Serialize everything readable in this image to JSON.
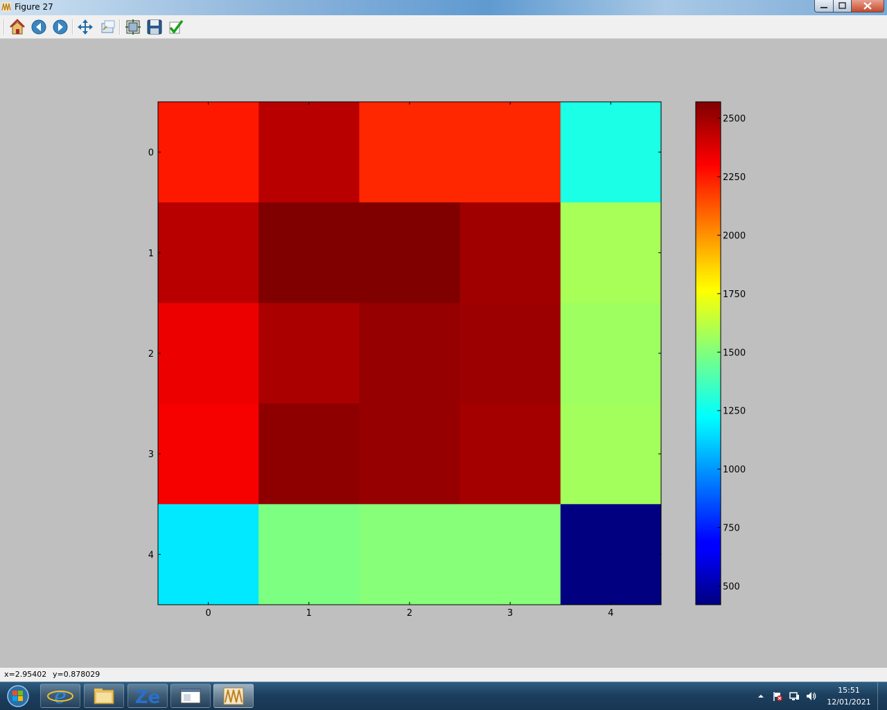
{
  "window": {
    "title": "Figure 27"
  },
  "toolbar": {
    "buttons": [
      {
        "name": "home-icon"
      },
      {
        "name": "back-icon"
      },
      {
        "name": "forward-icon"
      },
      {
        "name": "pan-icon"
      },
      {
        "name": "zoom-icon"
      },
      {
        "name": "subplots-config-icon"
      },
      {
        "name": "save-icon"
      },
      {
        "name": "edit-parameters-icon"
      }
    ]
  },
  "status": {
    "x": "x=2.95402",
    "y": "y=0.878029"
  },
  "taskbar": {
    "apps": [
      "ie-icon",
      "explorer-folder-icon",
      "zotero-icon",
      "window-app-icon",
      "matplotlib-figure-icon"
    ],
    "tray": [
      "show-hidden-icons-icon",
      "action-center-flag-icon",
      "network-icon",
      "volume-icon"
    ],
    "time": "15:51",
    "date": "12/01/2021"
  },
  "chart_data": {
    "type": "heatmap",
    "colormap": "jet",
    "x_ticks": [
      "0",
      "1",
      "2",
      "3",
      "4"
    ],
    "y_ticks": [
      "0",
      "1",
      "2",
      "3",
      "4"
    ],
    "values": [
      [
        2250,
        2450,
        2220,
        2220,
        1280
      ],
      [
        2450,
        2570,
        2570,
        2500,
        1580
      ],
      [
        2340,
        2480,
        2520,
        2510,
        1560
      ],
      [
        2320,
        2540,
        2520,
        2490,
        1570
      ],
      [
        1180,
        1490,
        1510,
        1510,
        420
      ]
    ],
    "colorbar": {
      "ticks": [
        "500",
        "750",
        "1000",
        "1250",
        "1500",
        "1750",
        "2000",
        "2250",
        "2500"
      ],
      "range": [
        420,
        2570
      ]
    }
  }
}
